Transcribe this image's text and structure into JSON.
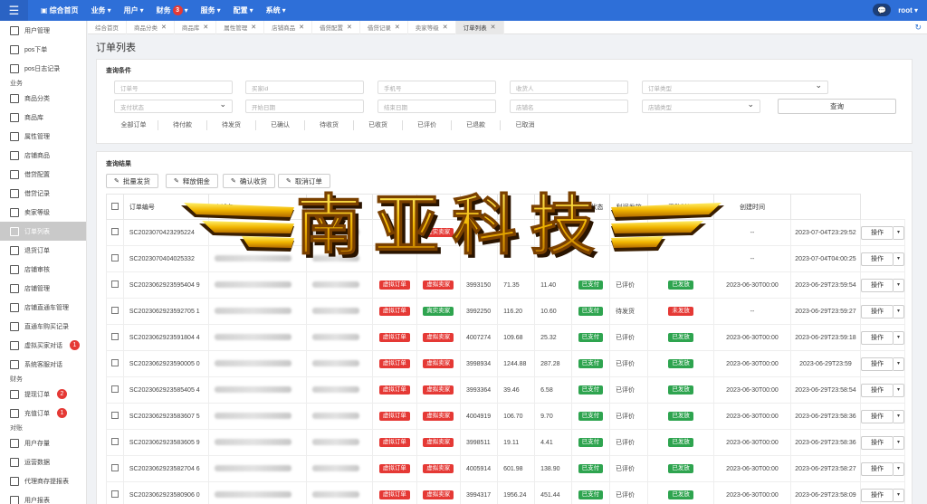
{
  "topbar": {
    "home": "综合首页",
    "menus": [
      "业务",
      "用户",
      "财务",
      "服务",
      "配置",
      "系统"
    ],
    "finance_badge": "3",
    "user": "root"
  },
  "sidebar": {
    "items": [
      {
        "label": "用户管理",
        "type": "item"
      },
      {
        "label": "pos下单",
        "type": "item"
      },
      {
        "label": "pos日志记录",
        "type": "item"
      },
      {
        "label": "业务",
        "type": "section"
      },
      {
        "label": "商品分类",
        "type": "item"
      },
      {
        "label": "商品库",
        "type": "item"
      },
      {
        "label": "属性管理",
        "type": "item"
      },
      {
        "label": "店铺商品",
        "type": "item"
      },
      {
        "label": "借贷配置",
        "type": "item"
      },
      {
        "label": "借贷记录",
        "type": "item"
      },
      {
        "label": "卖家等级",
        "type": "item"
      },
      {
        "label": "订单列表",
        "type": "item",
        "active": true
      },
      {
        "label": "退货订单",
        "type": "item"
      },
      {
        "label": "店铺审核",
        "type": "item"
      },
      {
        "label": "店铺管理",
        "type": "item"
      },
      {
        "label": "店铺直通车管理",
        "type": "item"
      },
      {
        "label": "直通车购买记录",
        "type": "item"
      },
      {
        "label": "虚拟买家对话",
        "type": "item",
        "badge": "1"
      },
      {
        "label": "系统客服对话",
        "type": "item"
      },
      {
        "label": "财务",
        "type": "section"
      },
      {
        "label": "提现订单",
        "type": "item",
        "badge": "2"
      },
      {
        "label": "充值订单",
        "type": "item",
        "badge": "1"
      },
      {
        "label": "对账",
        "type": "section"
      },
      {
        "label": "用户存量",
        "type": "item"
      },
      {
        "label": "运营数据",
        "type": "item"
      },
      {
        "label": "代理商存提报表",
        "type": "item"
      },
      {
        "label": "用户报表",
        "type": "item"
      }
    ]
  },
  "tabs": [
    "综合首页",
    "商品分类",
    "商品库",
    "属性管理",
    "店铺商品",
    "借贷配置",
    "借贷记录",
    "卖家等级",
    "订单列表"
  ],
  "page_title": "订单列表",
  "query": {
    "title": "查询条件",
    "placeholders": [
      "订单号",
      "买家id",
      "手机号",
      "收货人",
      "订单类型",
      "支付状态",
      "开始日期",
      "结束日期",
      "店铺名",
      "店铺类型"
    ],
    "search": "查询",
    "status_tabs": [
      "全部订单",
      "待付款",
      "待发货",
      "已确认",
      "待收货",
      "已收货",
      "已评价",
      "已退款",
      "已取消"
    ]
  },
  "result": {
    "title": "查询结果",
    "actions": [
      "批量发货",
      "释放佣金",
      "确认收货",
      "取消订单"
    ],
    "columns": [
      "",
      "订单编号",
      "店铺名",
      "",
      "",
      "",
      "",
      "",
      "",
      "订单状态",
      "利润发放",
      "采购时间",
      "创建时间",
      ""
    ],
    "op_label": "操作",
    "rows": [
      {
        "no": "SC2023070423295224",
        "t1": "",
        "t2": "虚实卖家",
        "v1": "",
        "v2": "",
        "v3": "",
        "pay": "",
        "status": "",
        "profit": "",
        "p": "--",
        "c": "2023-07-04T23:29:52"
      },
      {
        "no": "SC2023070404025332",
        "t1": "",
        "t2": "",
        "v1": "",
        "v2": "",
        "v3": "",
        "pay": "",
        "status": "",
        "profit": "",
        "p": "--",
        "c": "2023-07-04T04:00:25"
      },
      {
        "no": "SC2023062923595404 9",
        "t1": "虚拟订单",
        "t2": "虚拟卖家",
        "v1": "3993150",
        "v2": "71.35",
        "v3": "11.40",
        "pay": "已支付",
        "status": "已评价",
        "profit": "已发放",
        "p": "2023-06-30T00:00",
        "c": "2023-06-29T23:59:54"
      },
      {
        "no": "SC2023062923592705 1",
        "t1": "虚拟订单",
        "t2": "真实卖家",
        "v1": "3992250",
        "v2": "116.20",
        "v3": "10.60",
        "pay": "已支付",
        "status": "待发货",
        "profit": "未发放",
        "p": "--",
        "c": "2023-06-29T23:59:27"
      },
      {
        "no": "SC2023062923591804 4",
        "t1": "虚拟订单",
        "t2": "虚拟卖家",
        "v1": "4007274",
        "v2": "109.68",
        "v3": "25.32",
        "pay": "已支付",
        "status": "已评价",
        "profit": "已发放",
        "p": "2023-06-30T00:00",
        "c": "2023-06-29T23:59:18"
      },
      {
        "no": "SC2023062923590005 0",
        "t1": "虚拟订单",
        "t2": "虚拟卖家",
        "v1": "3998934",
        "v2": "1244.88",
        "v3": "287.28",
        "pay": "已支付",
        "status": "已评价",
        "profit": "已发放",
        "p": "2023-06-30T00:00",
        "c": "2023-06-29T23:59"
      },
      {
        "no": "SC2023062923585405 4",
        "t1": "虚拟订单",
        "t2": "虚拟卖家",
        "v1": "3993364",
        "v2": "39.46",
        "v3": "6.58",
        "pay": "已支付",
        "status": "已评价",
        "profit": "已发放",
        "p": "2023-06-30T00:00",
        "c": "2023-06-29T23:58:54"
      },
      {
        "no": "SC2023062923583607 5",
        "t1": "虚拟订单",
        "t2": "虚拟卖家",
        "v1": "4004919",
        "v2": "106.70",
        "v3": "9.70",
        "pay": "已支付",
        "status": "已评价",
        "profit": "已发放",
        "p": "2023-06-30T00:00",
        "c": "2023-06-29T23:58:36"
      },
      {
        "no": "SC2023062923583605 9",
        "t1": "虚拟订单",
        "t2": "虚拟卖家",
        "v1": "3998511",
        "v2": "19.11",
        "v3": "4.41",
        "pay": "已支付",
        "status": "已评价",
        "profit": "已发放",
        "p": "2023-06-30T00:00",
        "c": "2023-06-29T23:58:36"
      },
      {
        "no": "SC2023062923582704 6",
        "t1": "虚拟订单",
        "t2": "虚拟卖家",
        "v1": "4005914",
        "v2": "601.98",
        "v3": "138.90",
        "pay": "已支付",
        "status": "已评价",
        "profit": "已发放",
        "p": "2023-06-30T00:00",
        "c": "2023-06-29T23:58:27"
      },
      {
        "no": "SC2023062923580906 0",
        "t1": "虚拟订单",
        "t2": "虚拟卖家",
        "v1": "3994317",
        "v2": "1956.24",
        "v3": "451.44",
        "pay": "已支付",
        "status": "已评价",
        "profit": "已发放",
        "p": "2023-06-30T00:00",
        "c": "2023-06-29T23:58:09"
      }
    ]
  },
  "watermark": "南亚科技",
  "colors": {
    "topbar": "#2e6fd8",
    "tag_red": "#e53935",
    "tag_green": "#2ea44f",
    "watermark_gold": "#f2b600"
  }
}
